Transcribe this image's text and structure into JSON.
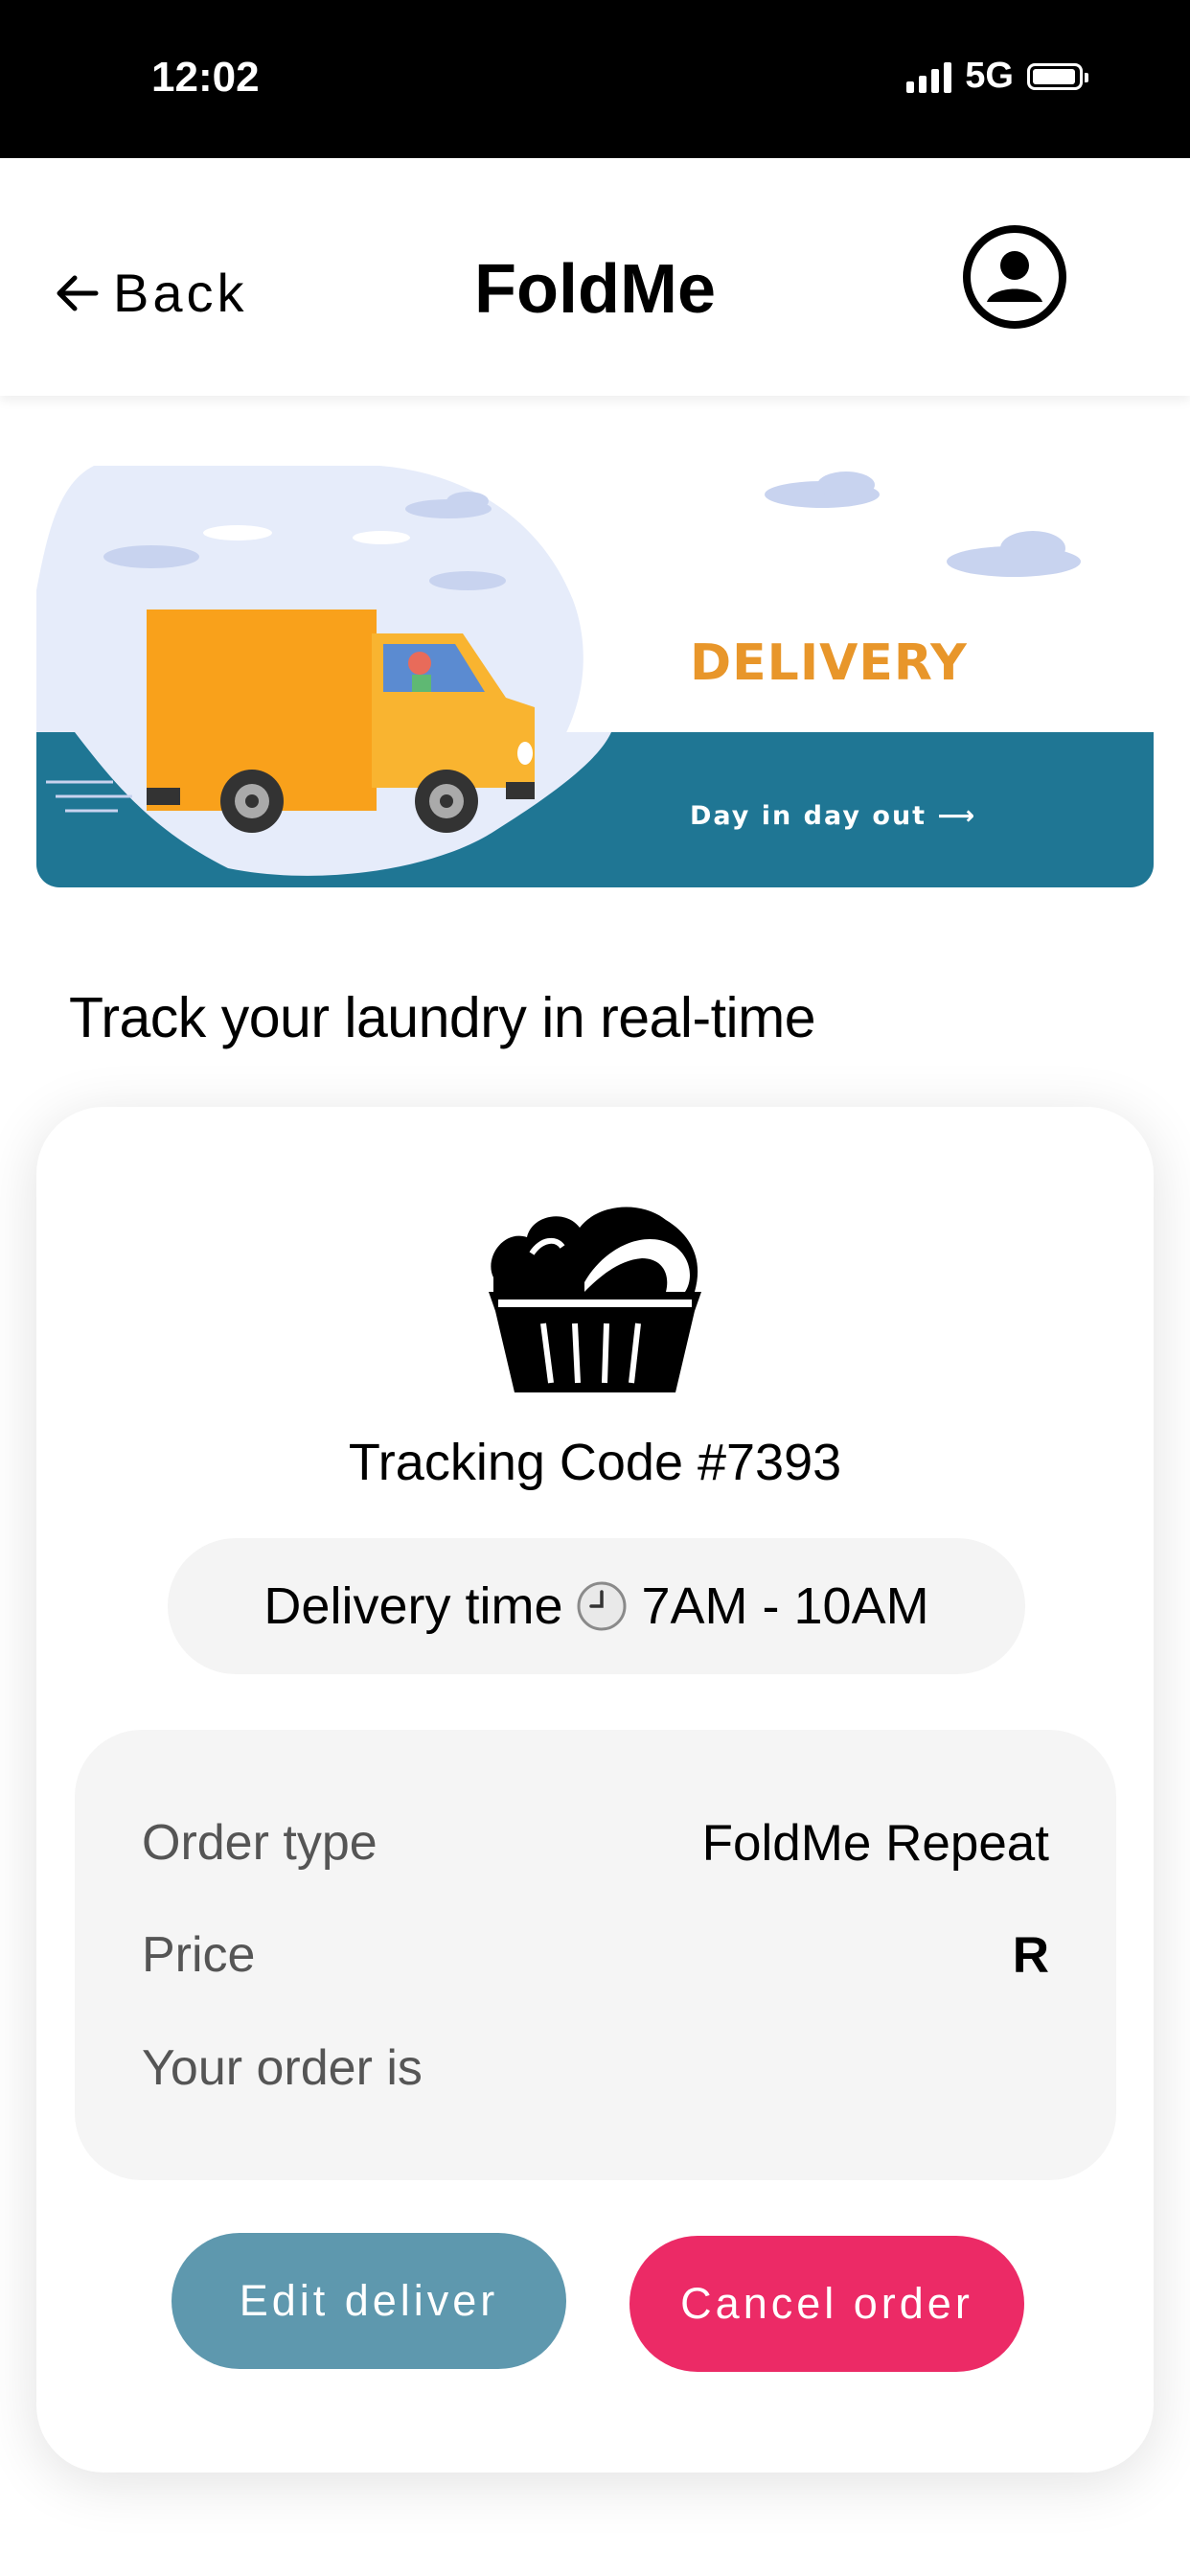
{
  "status_bar": {
    "time": "12:02",
    "network": "5G",
    "battery_level": 0.95
  },
  "header": {
    "back_label": "Back",
    "title": "FoldMe",
    "profile_icon": "user-circle-icon"
  },
  "banner": {
    "title": "DELIVERY",
    "tagline": "Day in day out ⟶"
  },
  "section_title": "Track your laundry in real-time",
  "order": {
    "tracking_label": "Tracking Code #7393",
    "delivery_time_label": "Delivery time",
    "delivery_time_value": "7AM - 10AM",
    "rows": [
      {
        "label": "Order type",
        "value": "FoldMe Repeat"
      },
      {
        "label": "Price",
        "value": "R"
      },
      {
        "label": "Your order is",
        "value": ""
      }
    ]
  },
  "actions": {
    "edit_label": "Edit deliver",
    "cancel_label": "Cancel order"
  },
  "colors": {
    "edit_button": "#5e98ae",
    "cancel_button": "#ec2a66",
    "banner_water": "#1f7694",
    "truck": "#f9a11b"
  }
}
